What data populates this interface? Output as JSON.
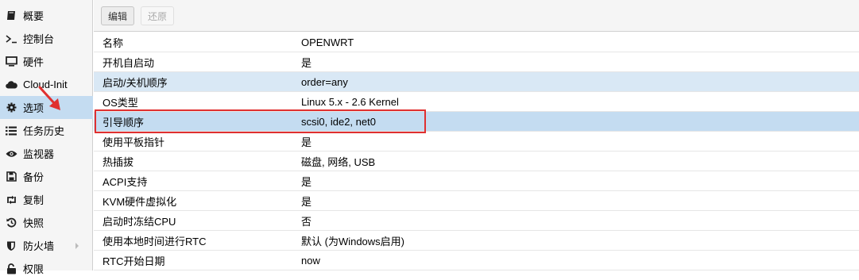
{
  "sidebar": {
    "items": [
      {
        "label": "概要",
        "icon": "book-icon"
      },
      {
        "label": "控制台",
        "icon": "terminal-icon"
      },
      {
        "label": "硬件",
        "icon": "monitor-icon"
      },
      {
        "label": "Cloud-Init",
        "icon": "cloud-icon"
      },
      {
        "label": "选项",
        "icon": "gear-icon"
      },
      {
        "label": "任务历史",
        "icon": "list-icon"
      },
      {
        "label": "监视器",
        "icon": "eye-icon"
      },
      {
        "label": "备份",
        "icon": "floppy-icon"
      },
      {
        "label": "复制",
        "icon": "retweet-icon"
      },
      {
        "label": "快照",
        "icon": "history-icon"
      },
      {
        "label": "防火墙",
        "icon": "shield-icon"
      },
      {
        "label": "权限",
        "icon": "unlock-icon"
      }
    ],
    "active_index": 4
  },
  "toolbar": {
    "edit_label": "编辑",
    "revert_label": "还原"
  },
  "options": {
    "rows": [
      {
        "key": "名称",
        "value": "OPENWRT"
      },
      {
        "key": "开机自启动",
        "value": "是"
      },
      {
        "key": "启动/关机顺序",
        "value": "order=any"
      },
      {
        "key": "OS类型",
        "value": "Linux 5.x - 2.6 Kernel"
      },
      {
        "key": "引导顺序",
        "value": "scsi0, ide2, net0"
      },
      {
        "key": "使用平板指针",
        "value": "是"
      },
      {
        "key": "热插拔",
        "value": "磁盘, 网络, USB"
      },
      {
        "key": "ACPI支持",
        "value": "是"
      },
      {
        "key": "KVM硬件虚拟化",
        "value": "是"
      },
      {
        "key": "启动时冻结CPU",
        "value": "否"
      },
      {
        "key": "使用本地时间进行RTC",
        "value": "默认 (为Windows启用)"
      },
      {
        "key": "RTC开始日期",
        "value": "now"
      }
    ],
    "selected_index": 4
  },
  "colors": {
    "selection": "#c4dcf1",
    "annotation": "#e03030"
  }
}
